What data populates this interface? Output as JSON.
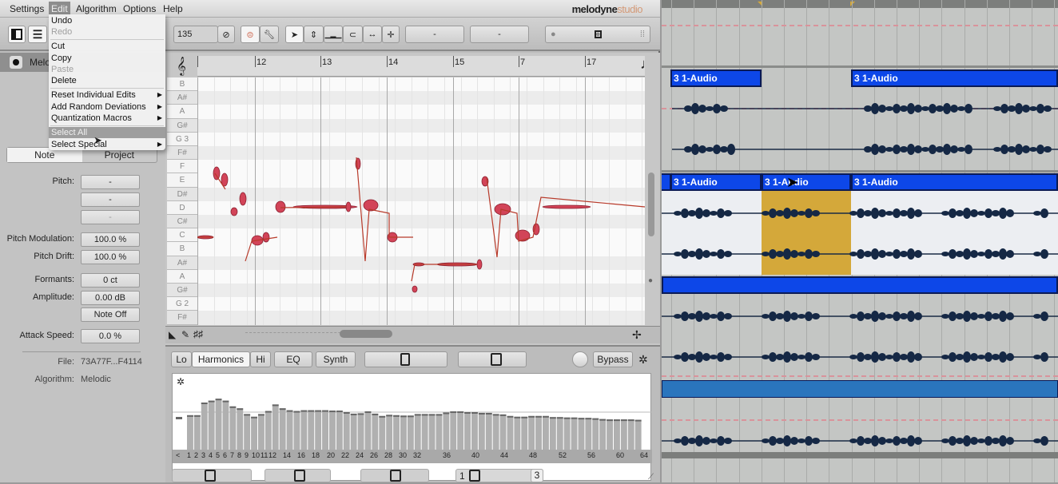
{
  "menubar": {
    "items": [
      "Settings",
      "Edit",
      "Algorithm",
      "Options",
      "Help"
    ],
    "active": "Edit",
    "logo_main": "melodyne",
    "logo_sub": "studio"
  },
  "edit_menu": {
    "items": [
      {
        "label": "Undo",
        "enabled": true
      },
      {
        "label": "Redo",
        "enabled": false
      },
      {
        "label": "Cut",
        "enabled": true
      },
      {
        "label": "Copy",
        "enabled": true
      },
      {
        "label": "Paste",
        "enabled": false
      },
      {
        "label": "Delete",
        "enabled": true
      },
      {
        "label": "Reset Individual Edits",
        "submenu": true
      },
      {
        "label": "Add Random Deviations",
        "submenu": true
      },
      {
        "label": "Quantization Macros",
        "submenu": true
      },
      {
        "label": "Select All",
        "highlighted": true
      },
      {
        "label": "Select Special",
        "submenu": true
      }
    ]
  },
  "toolbar": {
    "tempo": "135",
    "field1": "-",
    "field2": "-",
    "icons": [
      "layout-icon",
      "mixer-icon",
      "link-icon",
      "blob-icon",
      "wrench-icon",
      "pointer-tool-icon",
      "pitch-tool-icon",
      "amplitude-tool-icon",
      "formant-tool-icon",
      "time-tool-icon",
      "move-tool-icon"
    ]
  },
  "track": {
    "name": "Melo"
  },
  "inspector": {
    "tabs": [
      "Note",
      "Project"
    ],
    "active_tab": "Note",
    "pitch_label": "Pitch:",
    "pitch_values": [
      "-",
      "-",
      "-"
    ],
    "pitch_modulation_label": "Pitch Modulation:",
    "pitch_modulation": "100.0 %",
    "pitch_drift_label": "Pitch Drift:",
    "pitch_drift": "100.0 %",
    "formants_label": "Formants:",
    "formants": "0 ct",
    "amplitude_label": "Amplitude:",
    "amplitude": "0.00 dB",
    "note_off": "Note Off",
    "attack_speed_label": "Attack Speed:",
    "attack_speed": "0.0 %",
    "file_label": "File:",
    "file": "73A77F...F4114",
    "algorithm_label": "Algorithm:",
    "algorithm": "Melodic"
  },
  "editor": {
    "bars": [
      "",
      "12",
      "13",
      "14",
      "15",
      "7",
      "17"
    ],
    "keys": [
      "B",
      "A#",
      "A",
      "G#",
      "G 3",
      "F#",
      "F",
      "E",
      "D#",
      "D",
      "C#",
      "C",
      "B",
      "A#",
      "A",
      "G#",
      "G 2",
      "F#"
    ]
  },
  "sound_editor": {
    "tabs": [
      "Lo",
      "Harmonics",
      "Hi",
      "EQ",
      "Synth"
    ],
    "active_tab": "Harmonics",
    "bypass": "Bypass",
    "harmonic_labels": [
      "<",
      "1",
      "2",
      "3",
      "4",
      "5",
      "6",
      "7",
      "8",
      "9",
      "10",
      "11",
      "12",
      "14",
      "16",
      "18",
      "20",
      "22",
      "24",
      "26",
      "28",
      "30",
      "32",
      "36",
      "40",
      "44",
      "48",
      "52",
      "56",
      "60",
      "64"
    ],
    "harmonic_levels": [
      0.92,
      0.92,
      1.25,
      1.3,
      1.35,
      1.3,
      1.15,
      1.1,
      0.95,
      0.88,
      0.95,
      1.03,
      1.2,
      1.1,
      1.05,
      1.03,
      1.05,
      1.05,
      1.05,
      1.05,
      1.04,
      1.04,
      1.0,
      0.96,
      0.97,
      1.02,
      0.96,
      0.9,
      0.93,
      0.92,
      0.91,
      0.91,
      0.95,
      0.95,
      0.95,
      0.95,
      0.99,
      1.02,
      1.02,
      1.0,
      1.0,
      0.98,
      0.98,
      0.95,
      0.94,
      0.9,
      0.88,
      0.88,
      0.9,
      0.9,
      0.9,
      0.87,
      0.87,
      0.86,
      0.86,
      0.85,
      0.85,
      0.84,
      0.82,
      0.81,
      0.81,
      0.81,
      0.81,
      0.8
    ],
    "stepper_left": "1",
    "stepper_right": "3"
  },
  "daw": {
    "clip_label": "3 1-Audio",
    "clip_color": "#0d47e8",
    "selected_color": "#d4a83a"
  }
}
